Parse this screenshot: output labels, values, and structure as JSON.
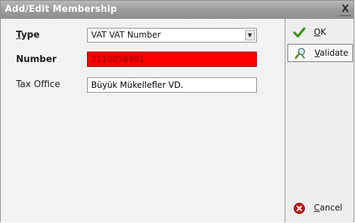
{
  "window": {
    "title": "Add/Edit Membership",
    "close_label": "X"
  },
  "form": {
    "type": {
      "label_first": "T",
      "label_rest": "ype",
      "value": "VAT VAT Number",
      "arrow": "▼"
    },
    "number": {
      "label": "Number",
      "value": "2110056991"
    },
    "tax_office": {
      "label": "Tax Office",
      "value": "Büyük Mükellefler VD."
    }
  },
  "actions": {
    "ok": {
      "label_first": "O",
      "label_rest": "K",
      "icon": "checkmark-icon"
    },
    "validate": {
      "label_first": "V",
      "label_rest": "alidate",
      "icon": "validate-icon"
    },
    "cancel": {
      "label_first": "C",
      "label_rest": "ancel",
      "icon": "cancel-icon"
    }
  },
  "colors": {
    "error_bg": "#ff0000",
    "ok_green": "#3a9a1a",
    "cancel_red": "#c01818"
  }
}
